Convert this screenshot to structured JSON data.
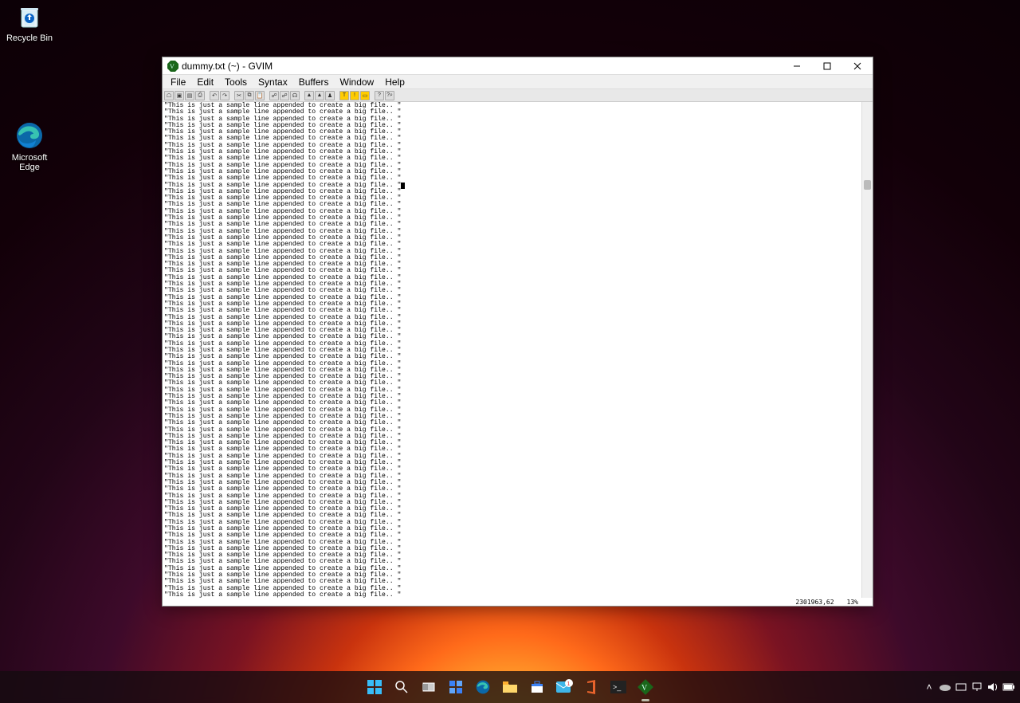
{
  "desktop": {
    "recycle_bin": "Recycle Bin",
    "edge": "Microsoft Edge"
  },
  "gvim": {
    "title": "dummy.txt (~) - GVIM",
    "menu": [
      "File",
      "Edit",
      "Tools",
      "Syntax",
      "Buffers",
      "Window",
      "Help"
    ],
    "sample_line": "\"This is just a sample line appended to create a big file.. \"",
    "cursor_line_index": 12,
    "visible_lines": 76,
    "status_pos": "2301963,62",
    "status_pct": "13%"
  },
  "taskbar": {
    "items": [
      "start",
      "search",
      "taskview",
      "widgets",
      "edge",
      "files",
      "store",
      "mail",
      "office",
      "terminal",
      "gvim"
    ]
  }
}
